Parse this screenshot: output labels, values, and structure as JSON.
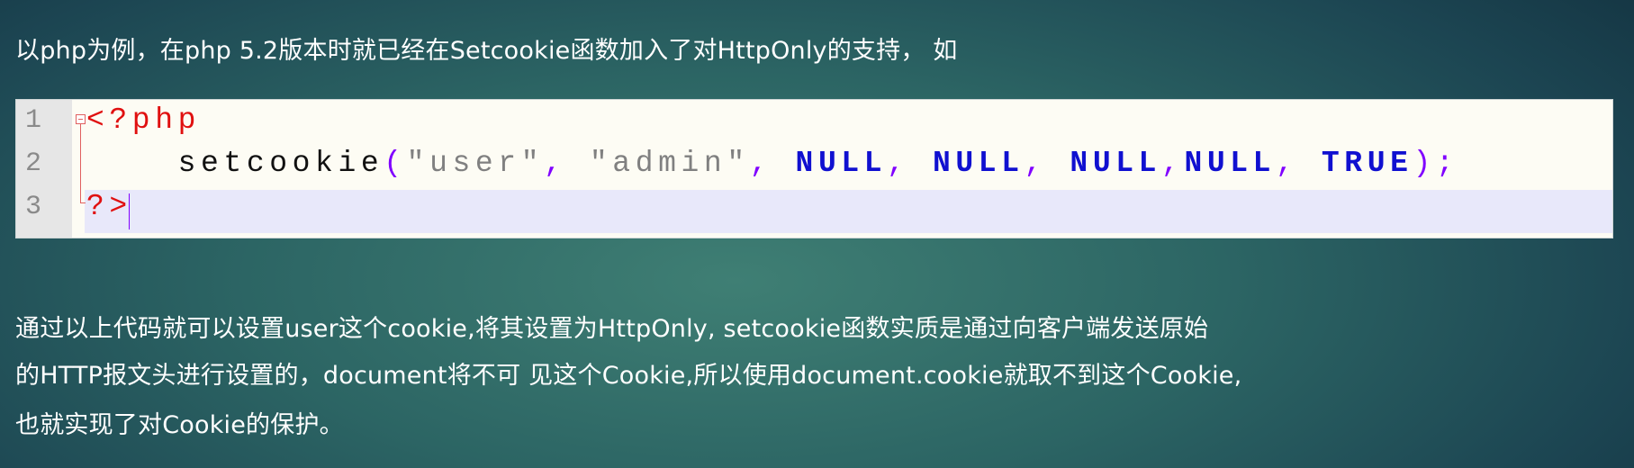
{
  "intro": "以php为例，在php 5.2版本时就已经在Setcookie函数加入了对HttpOnly的支持， 如",
  "code": {
    "line_numbers": [
      "1",
      "2",
      "3"
    ],
    "line1": {
      "tag": "<?php"
    },
    "line2": {
      "indent": "    ",
      "func": "setcookie",
      "open": "(",
      "arg1": "\"user\"",
      "c1": ", ",
      "arg2": "\"admin\"",
      "c2": ", ",
      "arg3": "NULL",
      "c3": ", ",
      "arg4": "NULL",
      "c4": ", ",
      "arg5": "NULL",
      "c5": ",",
      "arg6": "NULL",
      "c6": ", ",
      "arg7": "TRUE",
      "close": ");"
    },
    "line3": {
      "tag": "?>"
    }
  },
  "explanation": [
    "通过以上代码就可以设置user这个cookie,将其设置为HttpOnly, setcookie函数实质是通过向客户端发送原始",
    "的HTTP报文头进行设置的，document将不可 见这个Cookie,所以使用document.cookie就取不到这个Cookie,",
    "也就实现了对Cookie的保护。"
  ]
}
